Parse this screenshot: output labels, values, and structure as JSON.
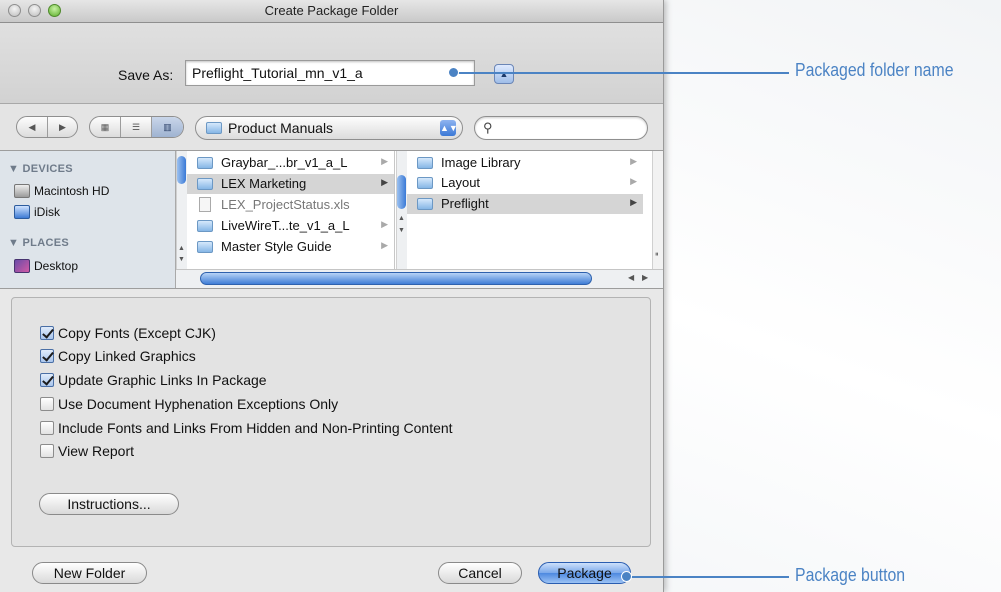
{
  "window": {
    "title": "Create Package Folder"
  },
  "save_as": {
    "label": "Save As:",
    "value": "Preflight_Tutorial_mn_v1_a"
  },
  "toolbar": {
    "location": "Product Manuals",
    "search_placeholder": ""
  },
  "sidebar": {
    "devices_header": "DEVICES",
    "devices": [
      "Macintosh HD",
      "iDisk"
    ],
    "places_header": "PLACES",
    "places": [
      "Desktop"
    ]
  },
  "columns": {
    "col1": [
      {
        "name": "Graybar_...br_v1_a_L",
        "kind": "folder"
      },
      {
        "name": "LEX Marketing",
        "kind": "folder",
        "selected": true
      },
      {
        "name": "LEX_ProjectStatus.xls",
        "kind": "file"
      },
      {
        "name": "LiveWireT...te_v1_a_L",
        "kind": "folder"
      },
      {
        "name": "Master Style Guide",
        "kind": "folder"
      }
    ],
    "col2": [
      {
        "name": "Image Library",
        "kind": "folder"
      },
      {
        "name": "Layout",
        "kind": "folder"
      },
      {
        "name": "Preflight",
        "kind": "folder",
        "selected": true
      }
    ]
  },
  "options": [
    {
      "label": "Copy Fonts (Except CJK)",
      "checked": true
    },
    {
      "label": "Copy Linked Graphics",
      "checked": true
    },
    {
      "label": "Update Graphic Links In Package",
      "checked": true
    },
    {
      "label": "Use Document Hyphenation Exceptions Only",
      "checked": false
    },
    {
      "label": "Include Fonts and Links From Hidden and Non-Printing Content",
      "checked": false
    },
    {
      "label": "View Report",
      "checked": false
    }
  ],
  "buttons": {
    "instructions": "Instructions...",
    "new_folder": "New Folder",
    "cancel": "Cancel",
    "package": "Package"
  },
  "callouts": {
    "folder_name": "Packaged folder name",
    "package_button": "Package button"
  },
  "colors": {
    "callout": "#4b83c4",
    "selection": "#3b78d6"
  }
}
